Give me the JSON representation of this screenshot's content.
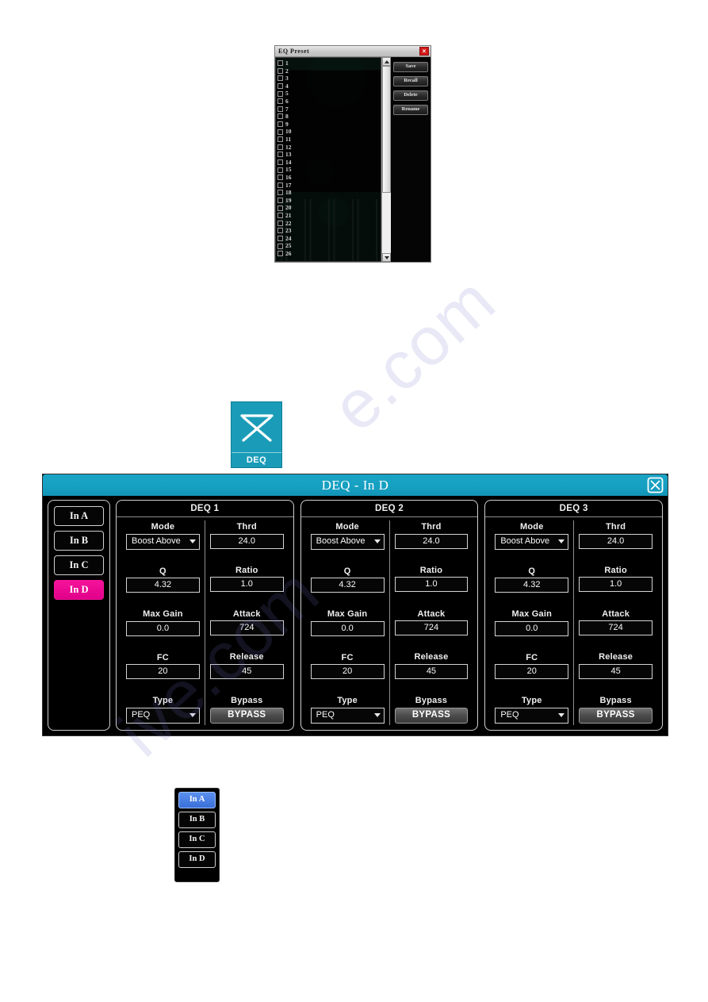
{
  "watermark": {
    "line1": "e.com",
    "line2": "ive.com"
  },
  "eq_preset_dialog": {
    "title": "EQ Preset",
    "close_icon": "×",
    "items": [
      {
        "num": "1"
      },
      {
        "num": "2"
      },
      {
        "num": "3"
      },
      {
        "num": "4"
      },
      {
        "num": "5"
      },
      {
        "num": "6"
      },
      {
        "num": "7"
      },
      {
        "num": "8"
      },
      {
        "num": "9"
      },
      {
        "num": "10"
      },
      {
        "num": "11"
      },
      {
        "num": "12"
      },
      {
        "num": "13"
      },
      {
        "num": "14"
      },
      {
        "num": "15"
      },
      {
        "num": "16"
      },
      {
        "num": "17"
      },
      {
        "num": "18"
      },
      {
        "num": "19"
      },
      {
        "num": "20"
      },
      {
        "num": "21"
      },
      {
        "num": "22"
      },
      {
        "num": "23"
      },
      {
        "num": "24"
      },
      {
        "num": "25"
      },
      {
        "num": "26"
      }
    ],
    "buttons": [
      {
        "label": "Save"
      },
      {
        "label": "Recall"
      },
      {
        "label": "Delete"
      },
      {
        "label": "Rename"
      }
    ]
  },
  "deq_app_icon": {
    "label": "DEQ",
    "background_color": "#1a9cb8"
  },
  "deq_window": {
    "title": "DEQ - In D",
    "close_icon": "X",
    "accent_color": "#16a0c2",
    "channel_selector": {
      "buttons": [
        {
          "label": "In A",
          "selected": false
        },
        {
          "label": "In B",
          "selected": false
        },
        {
          "label": "In C",
          "selected": false
        },
        {
          "label": "In D",
          "selected": true
        }
      ],
      "selected_color": "#ec008c"
    },
    "blocks": [
      {
        "title": "DEQ 1",
        "mode_label": "Mode",
        "mode_value": "Boost Above",
        "thrd_label": "Thrd",
        "thrd_value": "24.0",
        "q_label": "Q",
        "q_value": "4.32",
        "ratio_label": "Ratio",
        "ratio_value": "1.0",
        "maxgain_label": "Max Gain",
        "maxgain_value": "0.0",
        "attack_label": "Attack",
        "attack_value": "724",
        "fc_label": "FC",
        "fc_value": "20",
        "release_label": "Release",
        "release_value": "45",
        "type_label": "Type",
        "type_value": "PEQ",
        "bypass_label": "Bypass",
        "bypass_button": "BYPASS"
      },
      {
        "title": "DEQ 2",
        "mode_label": "Mode",
        "mode_value": "Boost Above",
        "thrd_label": "Thrd",
        "thrd_value": "24.0",
        "q_label": "Q",
        "q_value": "4.32",
        "ratio_label": "Ratio",
        "ratio_value": "1.0",
        "maxgain_label": "Max Gain",
        "maxgain_value": "0.0",
        "attack_label": "Attack",
        "attack_value": "724",
        "fc_label": "FC",
        "fc_value": "20",
        "release_label": "Release",
        "release_value": "45",
        "type_label": "Type",
        "type_value": "PEQ",
        "bypass_label": "Bypass",
        "bypass_button": "BYPASS"
      },
      {
        "title": "DEQ 3",
        "mode_label": "Mode",
        "mode_value": "Boost Above",
        "thrd_label": "Thrd",
        "thrd_value": "24.0",
        "q_label": "Q",
        "q_value": "4.32",
        "ratio_label": "Ratio",
        "ratio_value": "1.0",
        "maxgain_label": "Max Gain",
        "maxgain_value": "0.0",
        "attack_label": "Attack",
        "attack_value": "724",
        "fc_label": "FC",
        "fc_value": "20",
        "release_label": "Release",
        "release_value": "45",
        "type_label": "Type",
        "type_value": "PEQ",
        "bypass_label": "Bypass",
        "bypass_button": "BYPASS"
      }
    ]
  },
  "bottom_channel_selector": {
    "buttons": [
      {
        "label": "In A",
        "selected": true
      },
      {
        "label": "In B",
        "selected": false
      },
      {
        "label": "In C",
        "selected": false
      },
      {
        "label": "In D",
        "selected": false
      }
    ],
    "selected_color": "#3a6fd8"
  }
}
